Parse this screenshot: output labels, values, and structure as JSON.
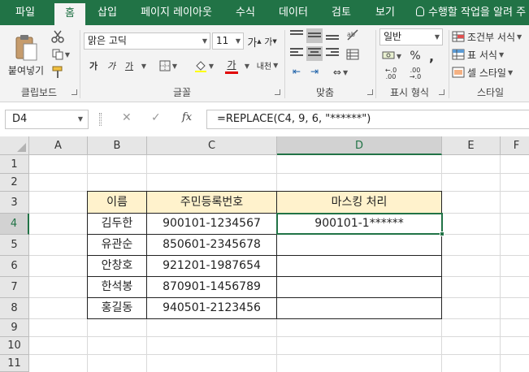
{
  "tabs": [
    {
      "label": "파일",
      "active": false
    },
    {
      "label": "홈",
      "active": true
    },
    {
      "label": "삽입",
      "active": false
    },
    {
      "label": "페이지 레이아웃",
      "active": false
    },
    {
      "label": "수식",
      "active": false
    },
    {
      "label": "데이터",
      "active": false
    },
    {
      "label": "검토",
      "active": false
    },
    {
      "label": "보기",
      "active": false
    }
  ],
  "tell_me": "수행할 작업을 알려 주",
  "ribbon": {
    "clipboard": {
      "paste_label": "붙여넣기",
      "group_label": "클립보드"
    },
    "font": {
      "font_name": "맑은 고딕",
      "font_size": "11",
      "bold": "가",
      "italic": "가",
      "underline": "가",
      "color_letter": "가",
      "phonetic": "내천",
      "group_label": "글꼴"
    },
    "alignment": {
      "group_label": "맞춤"
    },
    "number": {
      "format": "일반",
      "percent": "%",
      "comma": ",",
      "group_label": "표시 형식"
    },
    "styles": {
      "conditional": "조건부 서식",
      "table": "표 서식",
      "cell": "셀 스타일",
      "group_label": "스타일"
    }
  },
  "formula_bar": {
    "name_box": "D4",
    "cancel": "✕",
    "enter": "✓",
    "fx": "fx",
    "formula": "=REPLACE(C4, 9, 6, \"******\")"
  },
  "sheet": {
    "columns": [
      "A",
      "B",
      "C",
      "D",
      "E",
      "F"
    ],
    "rows": [
      "1",
      "2",
      "3",
      "4",
      "5",
      "6",
      "7",
      "8",
      "9",
      "10",
      "11"
    ],
    "selected_col": "D",
    "selected_row": "4",
    "table": {
      "headers": [
        "이름",
        "주민등록번호",
        "마스킹 처리"
      ],
      "rows": [
        [
          "김두한",
          "900101-1234567",
          "900101-1******"
        ],
        [
          "유관순",
          "850601-2345678",
          ""
        ],
        [
          "안창호",
          "921201-1987654",
          ""
        ],
        [
          "한석봉",
          "870901-1456789",
          ""
        ],
        [
          "홍길동",
          "940501-2123456",
          ""
        ]
      ]
    }
  },
  "colors": {
    "excel_green": "#217346",
    "header_fill": "#fff2cc"
  }
}
